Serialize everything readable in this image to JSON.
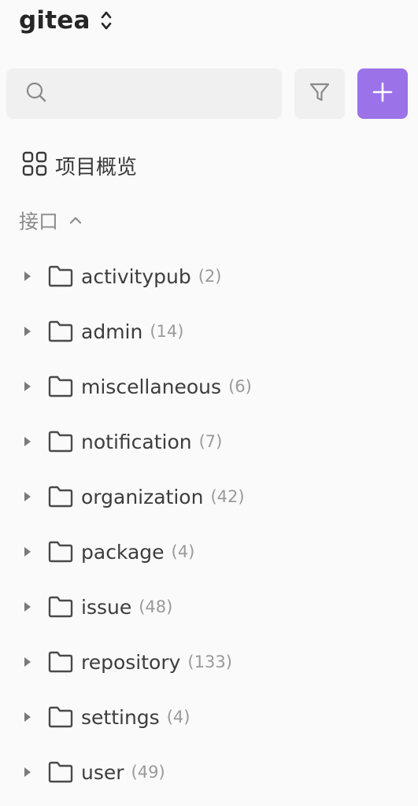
{
  "project": {
    "name": "gitea",
    "switch_icon": "chevron-up-down-icon"
  },
  "toolbar": {
    "search": {
      "placeholder": "",
      "value": "",
      "icon": "search-icon"
    },
    "filter_icon": "filter-icon",
    "add_icon": "plus-icon",
    "add_button_color": "#9b72e8"
  },
  "overview": {
    "label": "项目概览",
    "icon": "grid-icon"
  },
  "section": {
    "label": "接口",
    "icon": "chevron-up-icon",
    "expanded": true
  },
  "folders": [
    {
      "name": "activitypub",
      "count": "(2)"
    },
    {
      "name": "admin",
      "count": "(14)"
    },
    {
      "name": "miscellaneous",
      "count": "(6)"
    },
    {
      "name": "notification",
      "count": "(7)"
    },
    {
      "name": "organization",
      "count": "(42)"
    },
    {
      "name": "package",
      "count": "(4)"
    },
    {
      "name": "issue",
      "count": "(48)"
    },
    {
      "name": "repository",
      "count": "(133)"
    },
    {
      "name": "settings",
      "count": "(4)"
    },
    {
      "name": "user",
      "count": "(49)"
    }
  ]
}
